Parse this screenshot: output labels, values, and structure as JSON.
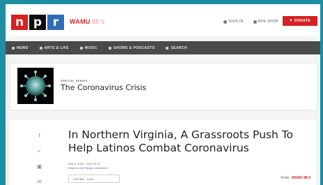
{
  "header": {
    "logo_letters": [
      "n",
      "p",
      "r"
    ],
    "station_name": "WAMU",
    "station_suffix": "88.5",
    "sign_in": "SIGN IN",
    "npr_shop": "NPR SHOP",
    "donate_label": "DONATE"
  },
  "nav": {
    "items": [
      {
        "label": "NEWS",
        "icon": "news-icon"
      },
      {
        "label": "ARTS & LIFE",
        "icon": "arts-icon"
      },
      {
        "label": "MUSIC",
        "icon": "music-icon"
      },
      {
        "label": "SHOWS & PODCASTS",
        "icon": "podcasts-icon"
      },
      {
        "label": "SEARCH",
        "icon": "search-icon"
      }
    ]
  },
  "series": {
    "kicker": "SPECIAL SERIES",
    "title": "The Coronavirus Crisis"
  },
  "article": {
    "headline": "In Northern Virginia, A Grassroots Push To Help Latinos Combat Coronavirus",
    "date": "May 8, 2020 · 4:06 PM ET",
    "heard_prefix": "Heard on ",
    "heard_show": "All Things Considered",
    "listen_label": "LISTEN · 3:43",
    "credit_prefix": "From",
    "credit_station": "WAMU 88.5"
  },
  "share_icons": [
    "facebook-icon",
    "twitter-icon",
    "flipboard-icon",
    "email-icon"
  ],
  "colors": {
    "npr_red": "#d62021",
    "npr_black": "#0f0f0f",
    "npr_blue": "#2f6db5",
    "nav_bg": "#4a4a4a",
    "page_bg": "#1e8fa3"
  }
}
